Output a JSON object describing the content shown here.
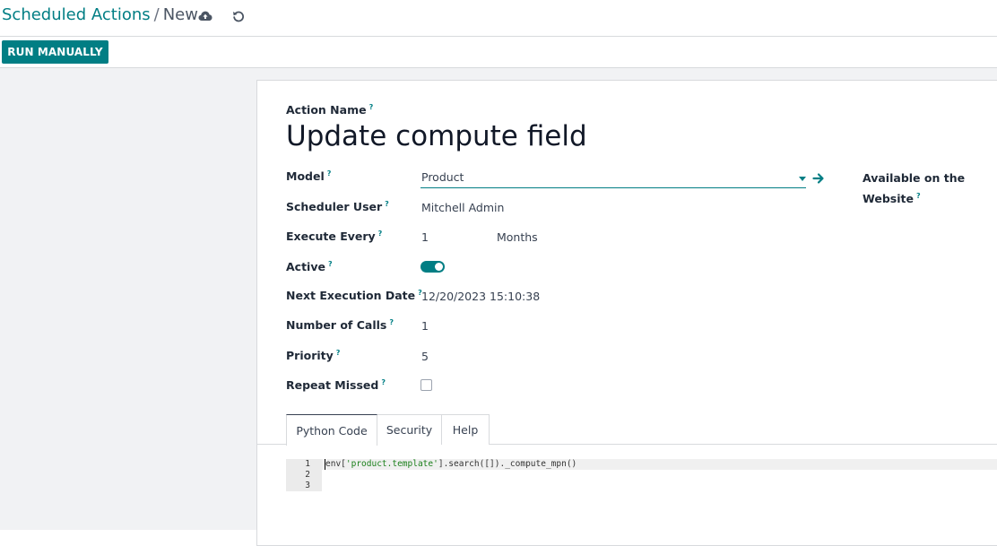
{
  "breadcrumb": {
    "parent": "Scheduled Actions",
    "separator": "/",
    "current": "New"
  },
  "icons": {
    "save": "cloud-upload-icon",
    "discard": "undo-icon",
    "open_record": "arrow-right-icon"
  },
  "actions": {
    "run_manually": "RUN MANUALLY"
  },
  "form": {
    "action_name_label": "Action Name",
    "action_name_value": "Update compute field",
    "tooltip_marker": "?",
    "model_label": "Model",
    "model_value": "Product",
    "available_website_label_line1": "Available on the",
    "available_website_label_line2": "Website",
    "scheduler_user_label": "Scheduler User",
    "scheduler_user_value": "Mitchell Admin",
    "execute_every_label": "Execute Every",
    "execute_every_number": "1",
    "execute_every_unit": "Months",
    "active_label": "Active",
    "active_value": true,
    "next_execution_label": "Next Execution Date",
    "next_execution_value": "12/20/2023 15:10:38",
    "number_calls_label": "Number of Calls",
    "number_calls_value": "1",
    "priority_label": "Priority",
    "priority_value": "5",
    "repeat_missed_label": "Repeat Missed",
    "repeat_missed_value": false
  },
  "tabs": [
    {
      "label": "Python Code",
      "active": true
    },
    {
      "label": "Security",
      "active": false
    },
    {
      "label": "Help",
      "active": false
    }
  ],
  "code": {
    "line_numbers": [
      "1",
      "2",
      "3"
    ],
    "line1_prefix": "env[",
    "line1_string": "'product.template'",
    "line1_suffix": "].search([])._compute_mpn()"
  },
  "colors": {
    "brand": "#017e84",
    "string_literal": "#1a7f1a"
  }
}
